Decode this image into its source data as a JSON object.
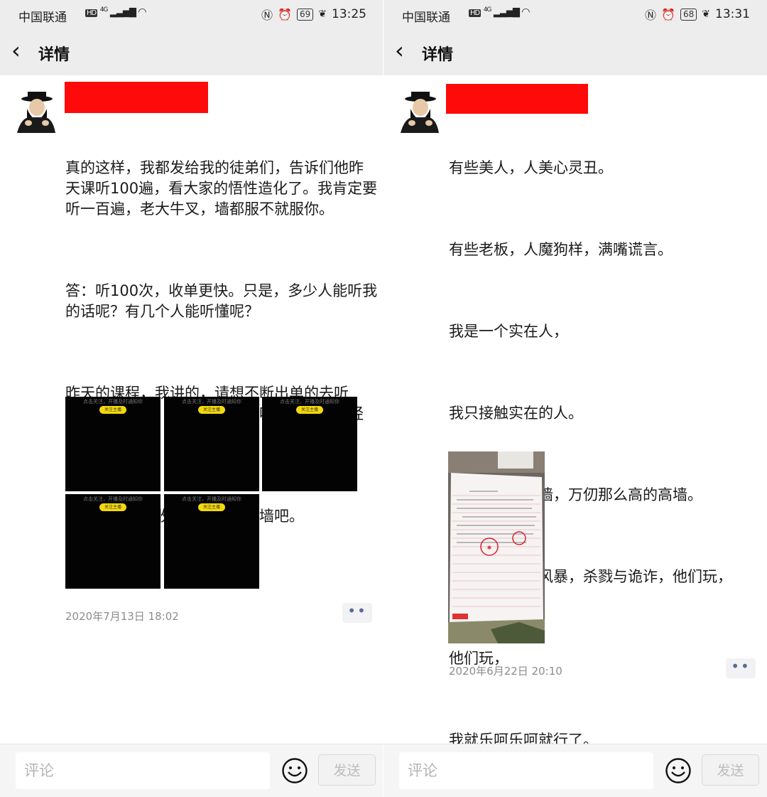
{
  "screens": [
    {
      "status": {
        "carrier": "中国联通",
        "hd": "HD",
        "network": "4G",
        "battery": "69",
        "time": "13:25"
      },
      "nav": {
        "back_glyph": "‹",
        "title": "详情"
      },
      "post": {
        "paragraphs": [
          "真的这样，我都发给我的徒弟们，告诉们他昨天课听100遍，看大家的悟性造化了。我肯定要听一百遍，老大牛叉，墙都服不就服你。",
          "答：听100次，收单更快。只是，多少人能听我的话呢？有几个人能听懂呢？",
          "昨天的课程，我讲的，请想不断出单的去听课，这么说吧，有的女老板很听话，现在已经非常爽了。",
          "哈哈哈。单子收的很多了。扶墙吧。"
        ],
        "thumb_follow_label": "关注主播",
        "thumb_caption": "点击关注，开播及时通知你",
        "timestamp": "2020年7月13日 18:02",
        "more_glyph": "••"
      },
      "bottom": {
        "comment_placeholder": "评论",
        "send_label": "发送"
      }
    },
    {
      "status": {
        "carrier": "中国联通",
        "hd": "HD",
        "network": "4G",
        "battery": "68",
        "time": "13:31"
      },
      "nav": {
        "back_glyph": "‹",
        "title": "详情"
      },
      "post": {
        "paragraphs": [
          "有些美人，人美心灵丑。",
          "有些老板，人魔狗样，满嘴谎言。",
          "我是一个实在人，",
          "我只接触实在的人。",
          "我们竖起了高墙，万仞那么高的高墙。",
          "外面，流沙与风暴，杀戮与诡诈，他们玩，",
          "他们玩，",
          "我就乐呵乐呵就行了。"
        ],
        "timestamp": "2020年6月22日 20:10",
        "more_glyph": "••"
      },
      "bottom": {
        "comment_placeholder": "评论",
        "send_label": "发送"
      }
    }
  ],
  "colors": {
    "nav_bg": "#ededed",
    "redaction": "#ff0a0a",
    "link_blue": "#576b95",
    "thumb_button": "#f4d90b"
  }
}
